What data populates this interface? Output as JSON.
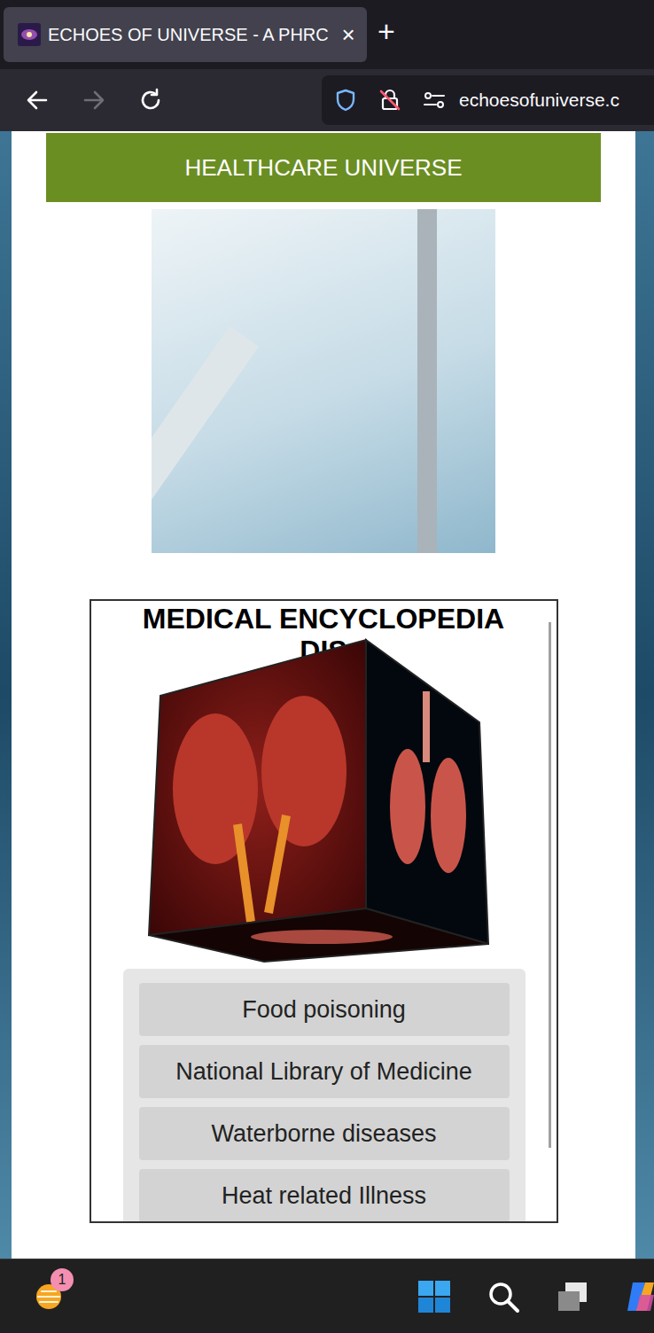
{
  "browser": {
    "tab": {
      "title": "ECHOES OF UNIVERSE - A PHRC",
      "close": "×",
      "selected": true
    },
    "new_tab": "+",
    "forward_disabled": true,
    "address": "echoesofuniverse.c"
  },
  "page": {
    "banner": "HEALTHCARE UNIVERSE",
    "encyclopedia": {
      "title": "MEDICAL ENCYCLOPEDIA",
      "subtitle": "DIS",
      "links": [
        "Food poisoning",
        "National Library of Medicine",
        "Waterborne diseases",
        "Heat related Illness"
      ]
    }
  },
  "taskbar": {
    "weather_badge": "1"
  }
}
